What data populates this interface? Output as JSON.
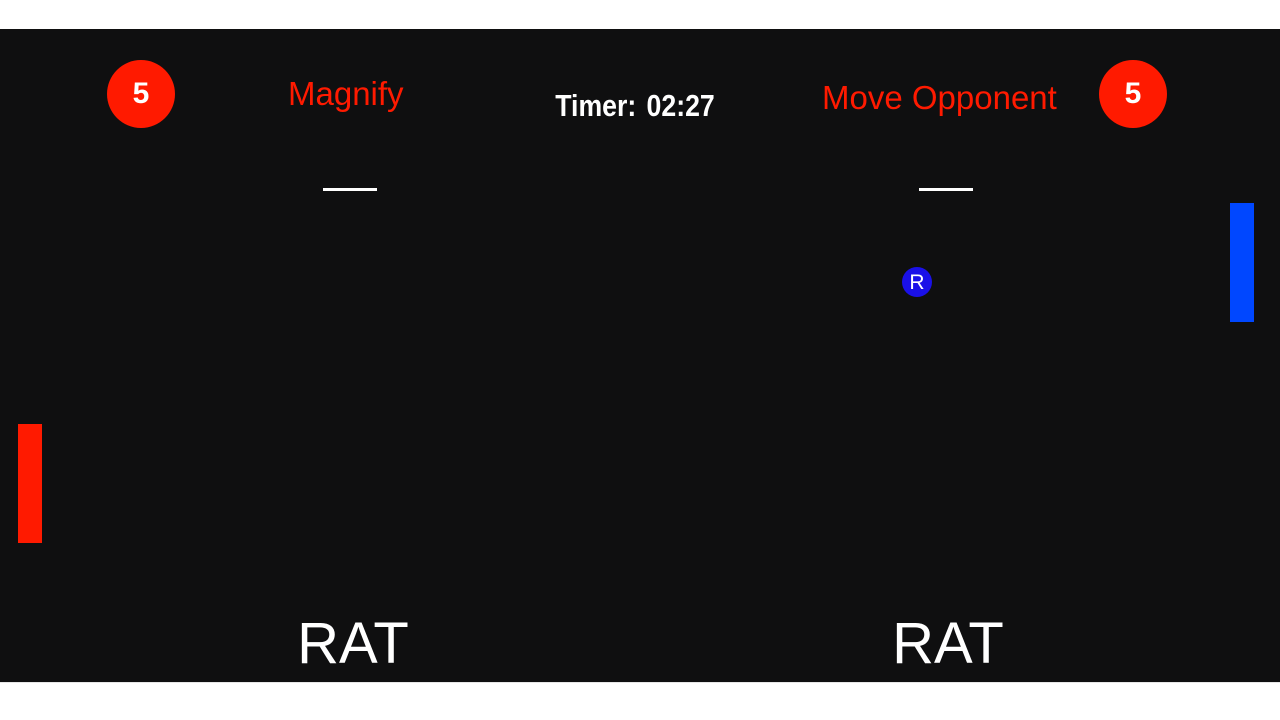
{
  "colors": {
    "background": "#0f0f10",
    "left_team": "#ff1a00",
    "right_team": "#0047ff",
    "ball": "#1a10e8",
    "text": "#ffffff"
  },
  "left_player": {
    "score": "5",
    "powerup": "Magnify",
    "name": "RAT",
    "paddle_icon": "red-paddle"
  },
  "right_player": {
    "score": "5",
    "powerup": "Move Opponent",
    "name": "RAT",
    "paddle_icon": "blue-paddle"
  },
  "timer": {
    "label": "Timer:",
    "value": "02:27"
  },
  "ball": {
    "label": "R"
  }
}
